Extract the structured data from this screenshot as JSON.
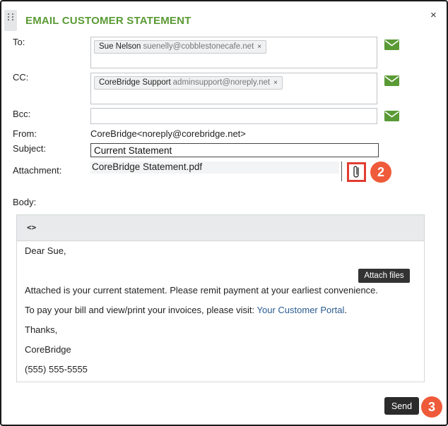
{
  "dialog": {
    "title": "EMAIL CUSTOMER STATEMENT",
    "close_label": "×"
  },
  "fields": {
    "to_label": "To:",
    "cc_label": "CC:",
    "bcc_label": "Bcc:",
    "from_label": "From:",
    "subject_label": "Subject:",
    "attachment_label": "Attachment:",
    "body_label": "Body:"
  },
  "to": {
    "name": "Sue Nelson",
    "email": "suenelly@cobblestonecafe.net",
    "remove": "×"
  },
  "cc": {
    "name": "CoreBridge Support",
    "email": "adminsupport@noreply.net",
    "remove": "×"
  },
  "bcc": {
    "value": ""
  },
  "from": {
    "value": "CoreBridge<noreply@corebridge.net>"
  },
  "subject": {
    "value": "Current Statement"
  },
  "attachment": {
    "filename": "CoreBridge Statement.pdf"
  },
  "editor": {
    "code_view_label": "<>",
    "lines": {
      "greeting": "Dear Sue,",
      "statement": "Attached is your current statement. Please remit payment at your earliest convenience.",
      "portal_prefix": "To pay your bill and view/print your invoices, please visit: ",
      "portal_link": "Your Customer Portal",
      "portal_suffix": ".",
      "thanks": "Thanks,",
      "signature": "CoreBridge",
      "phone": "(555) 555-5555"
    }
  },
  "tooltip": {
    "text": "Attach files"
  },
  "actions": {
    "send_label": "Send"
  },
  "callouts": {
    "attach_step": "2",
    "send_step": "3"
  },
  "colors": {
    "accent_green": "#5a9a35",
    "callout_red": "#ef5b3a",
    "highlight_border": "#e03c31",
    "link": "#2a5b8f"
  },
  "icons": {
    "mail": "envelope-icon",
    "attach": "paperclip-icon",
    "drag": "grip-icon"
  }
}
